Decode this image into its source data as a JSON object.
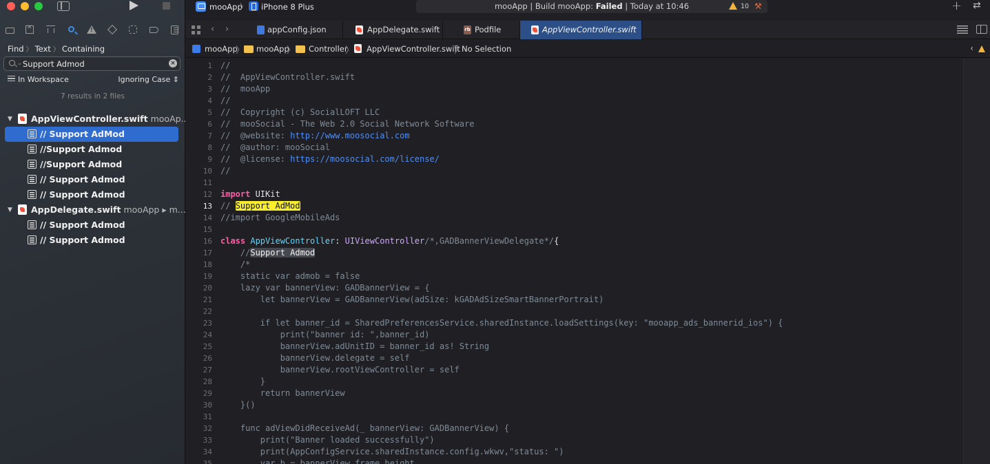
{
  "left": {
    "find_crumbs": [
      "Find",
      "Text",
      "Containing"
    ],
    "search": {
      "value": "Support Admod",
      "placeholder": ""
    },
    "scope": "In Workspace",
    "case": "Ignoring Case",
    "count": "7 results in 2 files",
    "files": [
      {
        "name": "AppViewController.swift",
        "path": "mooAp...",
        "matches": [
          "// Support AdMod",
          "//Support Admod",
          "//Support Admod",
          "// Support Admod",
          "// Support Admod"
        ]
      },
      {
        "name": "AppDelegate.swift",
        "path": "mooApp ▸ m...",
        "matches": [
          "// Support Admod",
          "// Support Admod"
        ]
      }
    ]
  },
  "toolbar": {
    "scheme": "mooApp",
    "device": "iPhone 8 Plus",
    "status_prefix": "mooApp | Build mooApp:",
    "status_result": "Failed",
    "status_suffix": "| Today at 10:46",
    "warnings": "10"
  },
  "tabs": [
    "appConfig.json",
    "AppDelegate.swift",
    "Podfile",
    "AppViewController.swift"
  ],
  "jumpbar": [
    "mooApp",
    "mooApp",
    "Controller",
    "AppViewController.swift",
    "No Selection"
  ],
  "code": {
    "line_numbers": [
      "1",
      "2",
      "3",
      "4",
      "5",
      "6",
      "7",
      "8",
      "9",
      "10",
      "11",
      "12",
      "13",
      "14",
      "15",
      "16",
      "17",
      "18",
      "19",
      "20",
      "21",
      "22",
      "23",
      "24",
      "25",
      "26",
      "27",
      "28",
      "29",
      "30",
      "31",
      "32",
      "33",
      "34",
      "35"
    ],
    "l1": "//",
    "l2": "//  AppViewController.swift",
    "l3": "//  mooApp",
    "l4": "//",
    "l5": "//  Copyright (c) SocialLOFT LLC",
    "l6": "//  mooSocial - The Web 2.0 Social Network Software",
    "l7a": "//  @website: ",
    "l7b": "http://www.moosocial.com",
    "l8": "//  @author: mooSocial",
    "l9a": "//  @license: ",
    "l9b": "https://moosocial.com/license/",
    "l10": "//",
    "l12a": "import",
    "l12b": " UIKit",
    "l13a": "// ",
    "l13b": "Support AdMod",
    "l14": "//import GoogleMobileAds",
    "l16a": "class",
    "l16b": "AppViewController",
    "l16c": ": ",
    "l16d": "UIViewController",
    "l16e": "/*,GADBannerViewDelegate*/",
    "l16f": "{",
    "l17a": "    //",
    "l17b": "Support Admod",
    "l18": "    /*",
    "l19": "    static var admob = false",
    "l20": "    lazy var bannerView: GADBannerView = {",
    "l21": "        let bannerView = GADBannerView(adSize: kGADAdSizeSmartBannerPortrait)",
    "l23": "        if let banner_id = SharedPreferencesService.sharedInstance.loadSettings(key: \"mooapp_ads_bannerid_ios\") {",
    "l24": "            print(\"banner id: \",banner_id)",
    "l25": "            bannerView.adUnitID = banner_id as! String",
    "l26": "            bannerView.delegate = self",
    "l27": "            bannerView.rootViewController = self",
    "l28": "        }",
    "l29": "        return bannerView",
    "l30": "    }()",
    "l32": "    func adViewDidReceiveAd(_ bannerView: GADBannerView) {",
    "l33": "        print(\"Banner loaded successfully\")",
    "l34": "        print(AppConfigService.sharedInstance.config.wkwv,\"status: \")",
    "l35": "        var h = bannerView.frame.height"
  }
}
